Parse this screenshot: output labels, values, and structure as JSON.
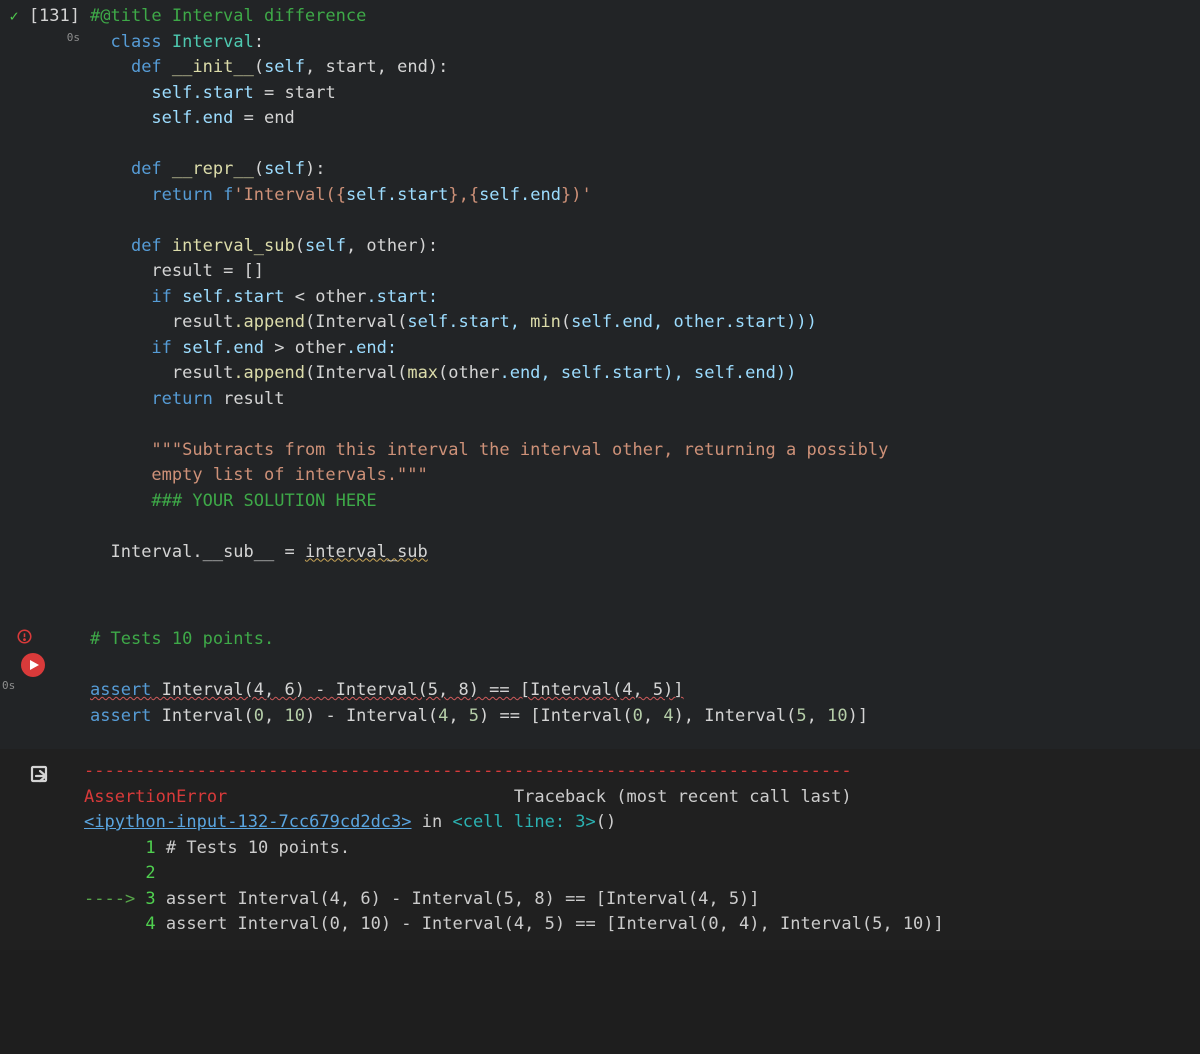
{
  "cell1": {
    "status_icon": "check",
    "timing": "0s",
    "exec_count": "[131]",
    "code": {
      "l1": "#@title Interval difference",
      "l2_kw": "class",
      "l2_name": "Interval",
      "l2_colon": ":",
      "l3_kw": "def",
      "l3_fn": "__init__",
      "l3_args_open": "(",
      "l3_self": "self",
      "l3_args": ", start, end):",
      "l4_self": "self",
      "l4_attr": ".start",
      "l4_eq": " = start",
      "l5_self": "self",
      "l5_attr": ".end",
      "l5_eq": " = end",
      "l6_kw": "def",
      "l6_fn": "__repr__",
      "l6_args": "(",
      "l6_self": "self",
      "l6_close": "):",
      "l7_kw": "return",
      "l7_fpre": " f",
      "l7_s1": "'Interval(",
      "l7_b1": "{",
      "l7_self1": "self",
      "l7_a1": ".start",
      "l7_b1c": "}",
      "l7_s2": ",",
      "l7_b2": "{",
      "l7_self2": "self",
      "l7_a2": ".end",
      "l7_b2c": "}",
      "l7_s3": ")'",
      "l8_kw": "def",
      "l8_fn": "interval_sub",
      "l8_args": "(",
      "l8_self": "self",
      "l8_rest": ", other):",
      "l9": "result = []",
      "l10_kw": "if",
      "l10_self": " self",
      "l10_a1": ".start",
      "l10_op": " < other",
      "l10_a2": ".start:",
      "l11_pre": "result",
      "l11_app": ".append",
      "l11_open": "(Interval(",
      "l11_self": "self",
      "l11_a1": ".start, ",
      "l11_min": "min",
      "l11_args": "(",
      "l11_self2": "self",
      "l11_a2": ".end, other",
      "l11_a3": ".start)))",
      "l12_kw": "if",
      "l12_self": " self",
      "l12_a1": ".end",
      "l12_op": " > other",
      "l12_a2": ".end:",
      "l13_pre": "result",
      "l13_app": ".append",
      "l13_open": "(Interval(",
      "l13_max": "max",
      "l13_args": "(other",
      "l13_a1": ".end, ",
      "l13_self": "self",
      "l13_a2": ".start), ",
      "l13_self2": "self",
      "l13_a3": ".end))",
      "l14_kw": "return",
      "l14_rest": " result",
      "l15": "\"\"\"Subtracts from this interval the interval other, returning a possibly",
      "l16": "empty list of intervals.\"\"\"",
      "l17": "### YOUR SOLUTION HERE",
      "l18_lhs": "Interval.__sub__ = ",
      "l18_rhs": "interval_sub"
    }
  },
  "cell2": {
    "status_icon": "error",
    "timing": "0s",
    "code": {
      "l1": "# Tests 10 points.",
      "l2_kw": "assert",
      "l2_body": " Interval(4, 6) - Interval(5, 8) == [Interval(4, 5)]",
      "l3_kw": "assert",
      "l3_a": " Interval(",
      "l3_n0": "0",
      "l3_c1": ", ",
      "l3_n10": "10",
      "l3_mid": ") - Interval(",
      "l3_n4": "4",
      "l3_c2": ", ",
      "l3_n5": "5",
      "l3_eq": ") == [Interval(",
      "l3_n0b": "0",
      "l3_c3": ", ",
      "l3_n4b": "4",
      "l3_mid2": "), Interval(",
      "l3_n5b": "5",
      "l3_c4": ", ",
      "l3_n10b": "10",
      "l3_end": ")]"
    }
  },
  "output": {
    "dashes": "---------------------------------------------------------------------------",
    "err_name": "AssertionError",
    "tb_header": "Traceback (most recent call last)",
    "frame_link": "<ipython-input-132-7cc679cd2dc3>",
    "frame_loc": " in ",
    "frame_cell": "<cell line: 3>",
    "frame_paren": "()",
    "line1_num": "1",
    "line1_txt": " # Tests 10 points.",
    "line2_num": "2",
    "arrow": "----> ",
    "line3_num": "3",
    "line3_txt": " assert Interval(4, 6) - Interval(5, 8) == [Interval(4, 5)]",
    "line4_num": "4",
    "line4_txt": " assert Interval(0, 10) - Interval(4, 5) == [Interval(0, 4), Interval(5, 10)]"
  }
}
